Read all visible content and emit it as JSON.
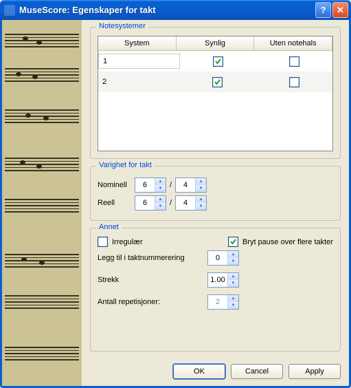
{
  "title": "MuseScore: Egenskaper for takt",
  "groups": {
    "notesystemer": {
      "legend": "Notesystemer",
      "headers": [
        "System",
        "Synlig",
        "Uten notehals"
      ],
      "rows": [
        {
          "system": "1",
          "synlig": true,
          "utenNotehals": false
        },
        {
          "system": "2",
          "synlig": true,
          "utenNotehals": false
        }
      ]
    },
    "varighet": {
      "legend": "Varighet for takt",
      "nominell_label": "Nominell",
      "reell_label": "Reell",
      "nominell_num": "6",
      "nominell_den": "4",
      "reell_num": "6",
      "reell_den": "4"
    },
    "annet": {
      "legend": "Annet",
      "irregular_label": "Irregulær",
      "irregular_checked": false,
      "break_label": "Bryt pause over flere takter",
      "break_checked": true,
      "addToBarNum_label": "Legg til i taktnummerering",
      "addToBarNum_value": "0",
      "stretch_label": "Strekk",
      "stretch_value": "1.00",
      "repeats_label": "Antall repetisjoner:",
      "repeats_value": "2"
    }
  },
  "buttons": {
    "ok": "OK",
    "cancel": "Cancel",
    "apply": "Apply"
  }
}
